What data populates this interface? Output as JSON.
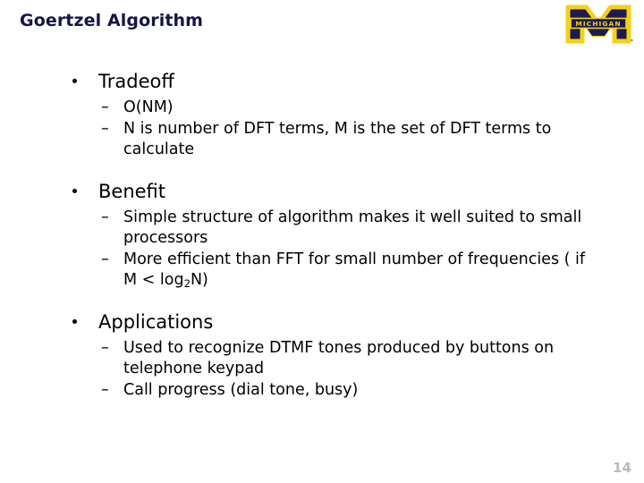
{
  "slide": {
    "title": "Goertzel Algorithm",
    "page_number": "14",
    "colors": {
      "title": "#151548",
      "body_text": "#000000",
      "page_number": "#b9b9b9",
      "logo_navy": "#1b1b52",
      "logo_maize": "#f5d016",
      "background": "#ffffff"
    }
  },
  "logo": {
    "name": "university-of-michigan-logo",
    "banner_text": "MICHIGAN"
  },
  "groups": [
    {
      "heading": "Tradeoff",
      "items": [
        "O(NM)",
        "N is number of DFT terms, M is the set of DFT terms to calculate"
      ]
    },
    {
      "heading": "Benefit",
      "items": [
        "Simple structure of algorithm makes it well suited to small processors",
        "More efficient than FFT for small number of frequencies ( if M < log2N)"
      ],
      "items_rich": [
        "Simple structure of algorithm makes it well suited to small processors",
        "More efficient than FFT for small number of frequencies ( if M < log<sub>2</sub>N)"
      ]
    },
    {
      "heading": "Applications",
      "items": [
        "Used to recognize DTMF tones produced by buttons on telephone keypad",
        "Call progress (dial tone, busy)"
      ]
    }
  ]
}
